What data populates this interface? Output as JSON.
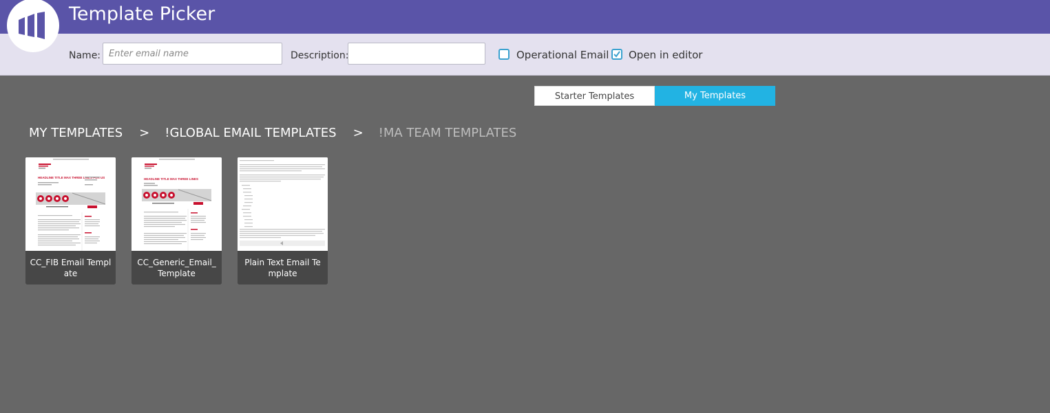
{
  "app": {
    "title": "Template Picker",
    "logo_icon": "marketo-logo-icon"
  },
  "form": {
    "name_label": "Name:",
    "name_placeholder": "Enter email name",
    "name_value": "",
    "description_label": "Description:",
    "description_value": "",
    "operational_label": "Operational Email",
    "operational_checked": false,
    "open_in_editor_label": "Open in editor",
    "open_in_editor_checked": true
  },
  "tabs": [
    {
      "label": "Starter Templates",
      "active": false
    },
    {
      "label": "My Templates",
      "active": true
    }
  ],
  "breadcrumb": {
    "items": [
      "MY TEMPLATES",
      "!GLOBAL EMAIL TEMPLATES",
      "!MA TEAM TEMPLATES"
    ],
    "separator": ">"
  },
  "templates": [
    {
      "name": "CC_FIB Email Template",
      "thumb_headline": "HEADLINE TITLE MAX THREE LINES FOR US"
    },
    {
      "name": "CC_Generic_Email_Template",
      "thumb_headline": "HEADLINE TITLE MAX THREE LINES"
    },
    {
      "name": "Plain Text Email Template"
    }
  ],
  "colors": {
    "accent": "#22b3e3",
    "header": "#5a54a8",
    "brand_red": "#c8102e"
  }
}
